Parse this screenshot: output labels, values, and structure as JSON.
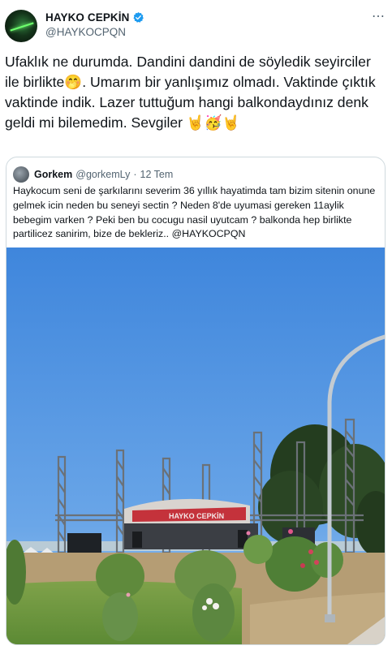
{
  "author": {
    "display_name": "HAYKO CEPKİN",
    "handle": "@HAYKOCPQN",
    "verified": true
  },
  "more_icon": "⋯",
  "tweet": {
    "text": "Ufaklık ne durumda. Dandini dandini de söyledik seyirciler ile birlikte🤭. Umarım bir yanlışımız olmadı. Vaktinde çıktık vaktinde indik. Lazer tuttuğum hangi balkondaydınız denk geldi mi bilemedim. Sevgiler 🤘🥳🤘"
  },
  "quoted_tweet": {
    "display_name": "Gorkem",
    "handle": "@gorkemLy",
    "separator": "·",
    "time": "12 Tem",
    "text": "Haykocum seni de şarkılarını severim 36 yıllık hayatimda tam bizim sitenin onune gelmek icin neden bu seneyi sectin ? Neden 8'de uyumasi gereken 11aylik bebegim varken ? Peki ben bu cocugu nasil uyutcam ? balkonda hep birlikte partilicez sanirim, bize de bekleriz.. @HAYKOCPQN",
    "photo": {
      "banner_text": "HAYKO CEPKİN"
    }
  },
  "colors": {
    "text": "#0f1419",
    "secondary": "#536471",
    "border": "#cfd9de",
    "verified": "#1d9bf0",
    "sky": "#4a8fe0"
  }
}
